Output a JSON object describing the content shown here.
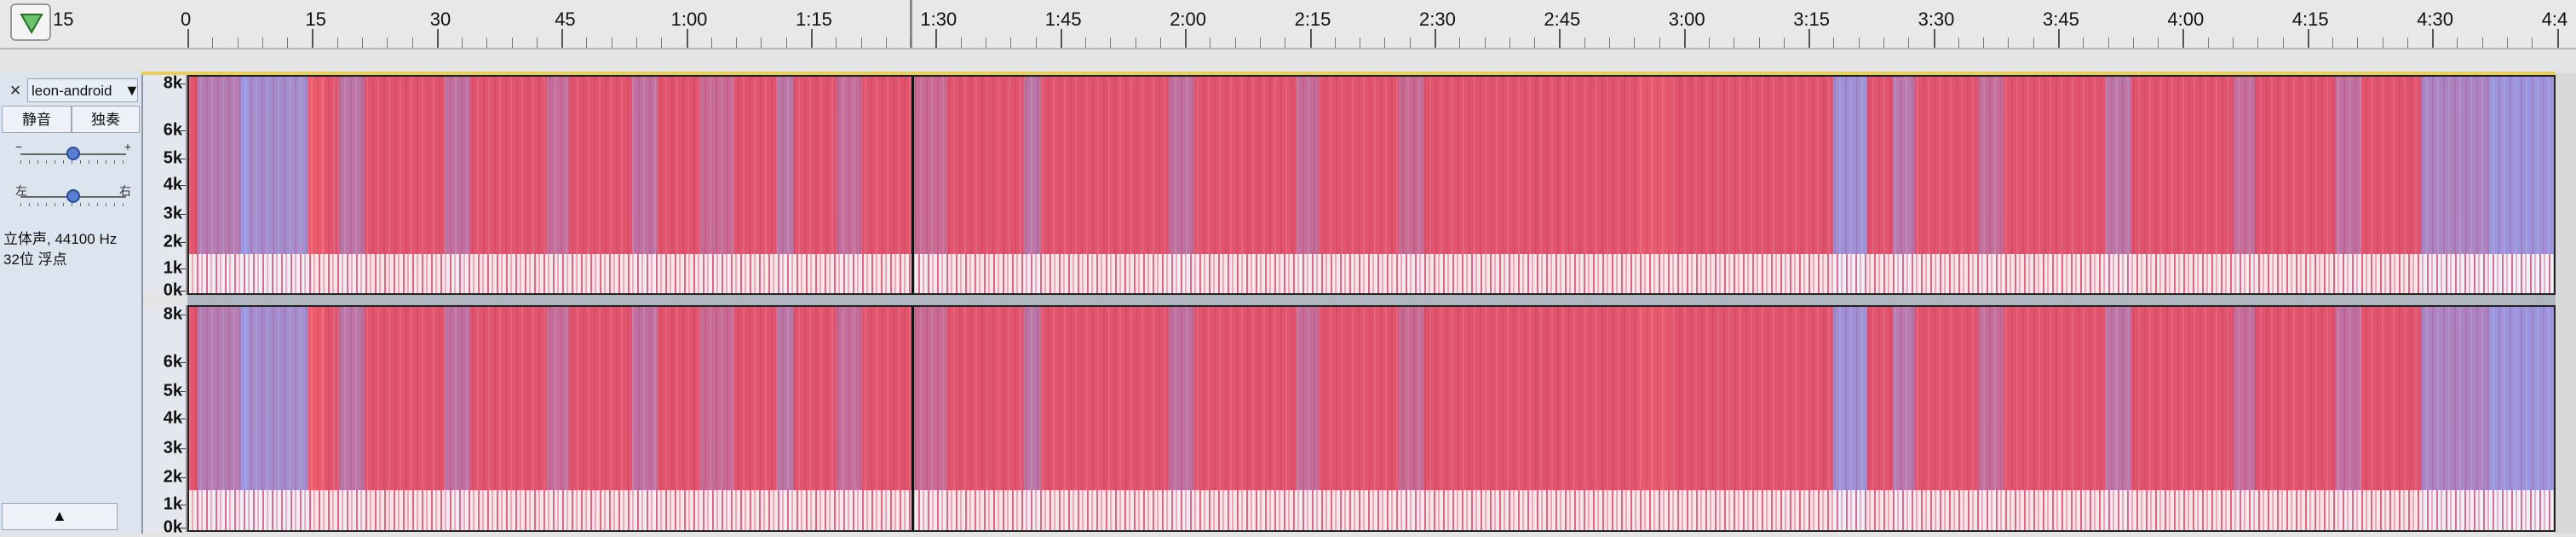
{
  "ruler": {
    "labels": [
      "15",
      "0",
      "15",
      "30",
      "45",
      "1:00",
      "1:15",
      "1:30",
      "1:45",
      "2:00",
      "2:15",
      "2:30",
      "2:45",
      "3:00",
      "3:15",
      "3:30",
      "3:45",
      "4:00",
      "4:15",
      "4:30",
      "4:4"
    ],
    "leading_dot_label": "·15"
  },
  "track": {
    "name": "leon-android",
    "mute_label": "静音",
    "solo_label": "独奏",
    "gain_minus": "−",
    "gain_plus": "+",
    "pan_left": "左",
    "pan_right": "右",
    "gain_value": 0.5,
    "pan_value": 0.5,
    "info_line1": "立体声, 44100 Hz",
    "info_line2": "32位 浮点",
    "close_glyph": "×",
    "menu_glyph": "▼",
    "collapse_glyph": "▲"
  },
  "spectrogram": {
    "freq_labels": [
      "8k",
      "6k",
      "5k",
      "4k",
      "3k",
      "2k",
      "1k",
      "0k"
    ],
    "colors": {
      "base": "#e0546e",
      "cool": "#8fa0f0",
      "hot": "#ff6a6a",
      "peak": "#ffffff"
    }
  },
  "icons": {
    "play": "play-triangle-icon",
    "close": "close-icon",
    "menu": "chevron-down-icon",
    "collapse": "collapse-up-icon"
  }
}
